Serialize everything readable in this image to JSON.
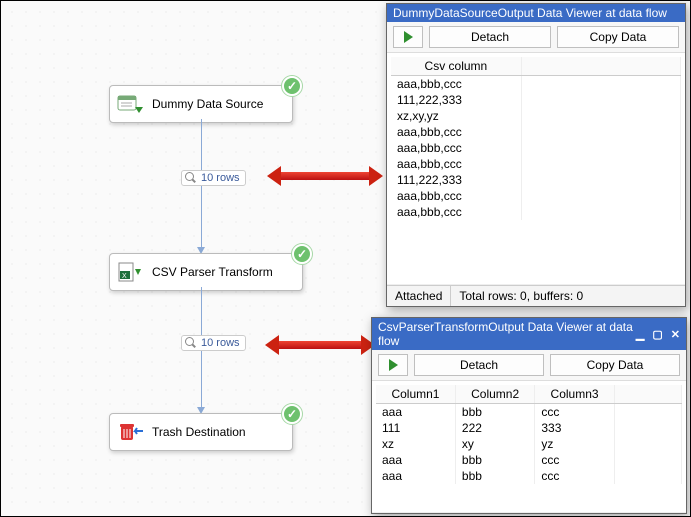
{
  "nodes": {
    "source": {
      "label": "Dummy Data Source"
    },
    "parser": {
      "label": "CSV Parser Transform"
    },
    "trash": {
      "label": "Trash Destination"
    }
  },
  "edges": {
    "top": {
      "label": "10 rows"
    },
    "bottom": {
      "label": "10 rows"
    }
  },
  "viewer1": {
    "title": "DummyDataSourceOutput Data Viewer at data flow",
    "buttons": {
      "detach": "Detach",
      "copy": "Copy Data"
    },
    "columns": [
      "Csv column"
    ],
    "rows": [
      [
        "aaa,bbb,ccc"
      ],
      [
        "111,222,333"
      ],
      [
        "xz,xy,yz"
      ],
      [
        "aaa,bbb,ccc"
      ],
      [
        "aaa,bbb,ccc"
      ],
      [
        "aaa,bbb,ccc"
      ],
      [
        "111,222,333"
      ],
      [
        "aaa,bbb,ccc"
      ],
      [
        "aaa,bbb,ccc"
      ]
    ],
    "status": {
      "attached": "Attached",
      "totals": "Total rows: 0, buffers: 0"
    }
  },
  "viewer2": {
    "title": "CsvParserTransformOutput Data Viewer at data flow",
    "buttons": {
      "detach": "Detach",
      "copy": "Copy Data"
    },
    "columns": [
      "Column1",
      "Column2",
      "Column3"
    ],
    "rows": [
      [
        "aaa",
        "bbb",
        "ccc"
      ],
      [
        "111",
        "222",
        "333"
      ],
      [
        "xz",
        "xy",
        "yz"
      ],
      [
        "aaa",
        "bbb",
        "ccc"
      ],
      [
        "aaa",
        "bbb",
        "ccc"
      ]
    ]
  }
}
